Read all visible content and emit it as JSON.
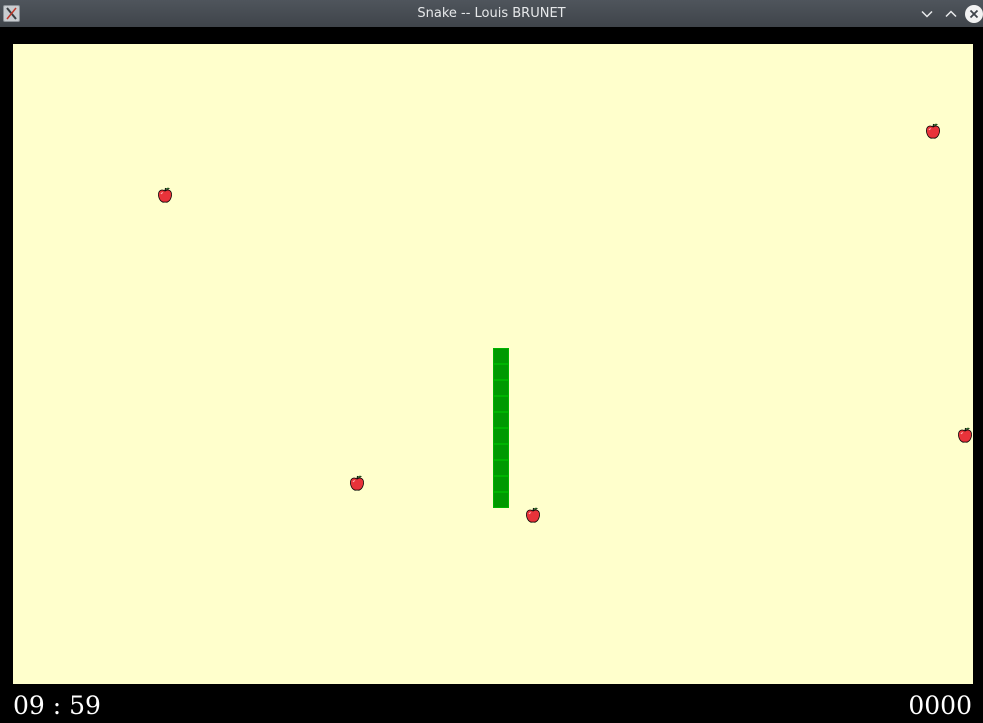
{
  "window": {
    "title": "Snake -- Louis BRUNET",
    "icons": {
      "app": "x-window-icon",
      "minimize": "chevron-down-icon",
      "maximize": "chevron-up-icon",
      "close": "close-icon"
    }
  },
  "colors": {
    "board_background": "#ffffcc",
    "snake": "#009900",
    "apple": "#e8333a",
    "hud_text": "#ffffff",
    "frame": "#000000"
  },
  "game": {
    "snake_length": 10,
    "apple_count": 5
  },
  "hud": {
    "timer": "09 : 59",
    "score": "0000"
  }
}
